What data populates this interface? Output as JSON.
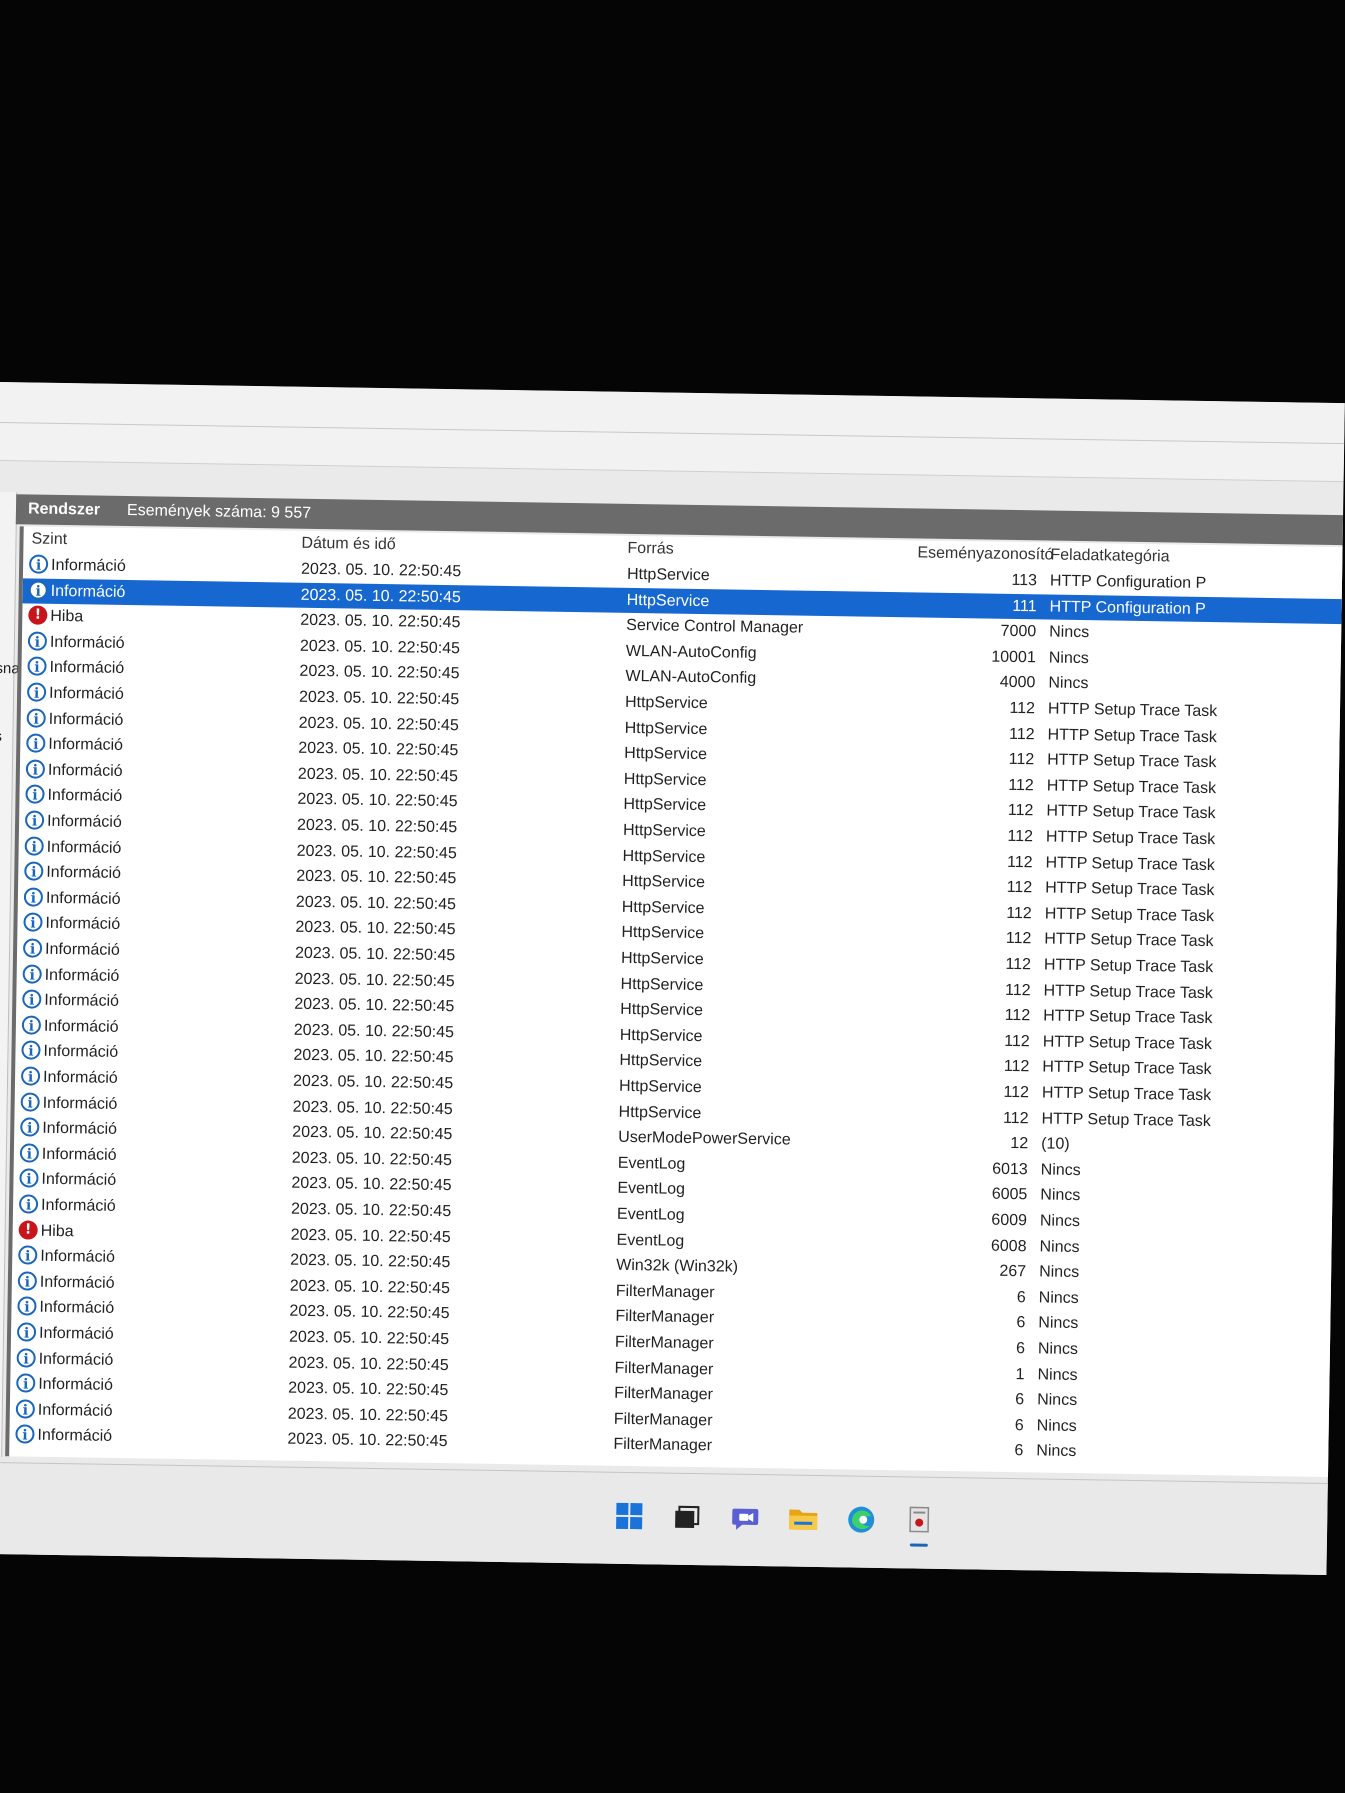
{
  "panel": {
    "title": "Rendszer",
    "count_text": "Események száma: 9 557"
  },
  "left_edge": [
    "sna",
    "s"
  ],
  "columns": {
    "level": "Szint",
    "date": "Dátum és idő",
    "source": "Forrás",
    "id": "Eseményazonosító",
    "category": "Feladatkategória"
  },
  "rows": [
    {
      "level": "Információ",
      "type": "info",
      "date": "2023. 05. 10. 22:50:45",
      "source": "HttpService",
      "id": "113",
      "category": "HTTP Configuration P"
    },
    {
      "level": "Információ",
      "type": "info",
      "date": "2023. 05. 10. 22:50:45",
      "source": "HttpService",
      "id": "111",
      "category": "HTTP Configuration P",
      "selected": true
    },
    {
      "level": "Hiba",
      "type": "error",
      "date": "2023. 05. 10. 22:50:45",
      "source": "Service Control Manager",
      "id": "7000",
      "category": "Nincs"
    },
    {
      "level": "Információ",
      "type": "info",
      "date": "2023. 05. 10. 22:50:45",
      "source": "WLAN-AutoConfig",
      "id": "10001",
      "category": "Nincs"
    },
    {
      "level": "Információ",
      "type": "info",
      "date": "2023. 05. 10. 22:50:45",
      "source": "WLAN-AutoConfig",
      "id": "4000",
      "category": "Nincs"
    },
    {
      "level": "Információ",
      "type": "info",
      "date": "2023. 05. 10. 22:50:45",
      "source": "HttpService",
      "id": "112",
      "category": "HTTP Setup Trace Task"
    },
    {
      "level": "Információ",
      "type": "info",
      "date": "2023. 05. 10. 22:50:45",
      "source": "HttpService",
      "id": "112",
      "category": "HTTP Setup Trace Task"
    },
    {
      "level": "Információ",
      "type": "info",
      "date": "2023. 05. 10. 22:50:45",
      "source": "HttpService",
      "id": "112",
      "category": "HTTP Setup Trace Task"
    },
    {
      "level": "Információ",
      "type": "info",
      "date": "2023. 05. 10. 22:50:45",
      "source": "HttpService",
      "id": "112",
      "category": "HTTP Setup Trace Task"
    },
    {
      "level": "Információ",
      "type": "info",
      "date": "2023. 05. 10. 22:50:45",
      "source": "HttpService",
      "id": "112",
      "category": "HTTP Setup Trace Task"
    },
    {
      "level": "Információ",
      "type": "info",
      "date": "2023. 05. 10. 22:50:45",
      "source": "HttpService",
      "id": "112",
      "category": "HTTP Setup Trace Task"
    },
    {
      "level": "Információ",
      "type": "info",
      "date": "2023. 05. 10. 22:50:45",
      "source": "HttpService",
      "id": "112",
      "category": "HTTP Setup Trace Task"
    },
    {
      "level": "Információ",
      "type": "info",
      "date": "2023. 05. 10. 22:50:45",
      "source": "HttpService",
      "id": "112",
      "category": "HTTP Setup Trace Task"
    },
    {
      "level": "Információ",
      "type": "info",
      "date": "2023. 05. 10. 22:50:45",
      "source": "HttpService",
      "id": "112",
      "category": "HTTP Setup Trace Task"
    },
    {
      "level": "Információ",
      "type": "info",
      "date": "2023. 05. 10. 22:50:45",
      "source": "HttpService",
      "id": "112",
      "category": "HTTP Setup Trace Task"
    },
    {
      "level": "Információ",
      "type": "info",
      "date": "2023. 05. 10. 22:50:45",
      "source": "HttpService",
      "id": "112",
      "category": "HTTP Setup Trace Task"
    },
    {
      "level": "Információ",
      "type": "info",
      "date": "2023. 05. 10. 22:50:45",
      "source": "HttpService",
      "id": "112",
      "category": "HTTP Setup Trace Task"
    },
    {
      "level": "Információ",
      "type": "info",
      "date": "2023. 05. 10. 22:50:45",
      "source": "HttpService",
      "id": "112",
      "category": "HTTP Setup Trace Task"
    },
    {
      "level": "Információ",
      "type": "info",
      "date": "2023. 05. 10. 22:50:45",
      "source": "HttpService",
      "id": "112",
      "category": "HTTP Setup Trace Task"
    },
    {
      "level": "Információ",
      "type": "info",
      "date": "2023. 05. 10. 22:50:45",
      "source": "HttpService",
      "id": "112",
      "category": "HTTP Setup Trace Task"
    },
    {
      "level": "Információ",
      "type": "info",
      "date": "2023. 05. 10. 22:50:45",
      "source": "HttpService",
      "id": "112",
      "category": "HTTP Setup Trace Task"
    },
    {
      "level": "Információ",
      "type": "info",
      "date": "2023. 05. 10. 22:50:45",
      "source": "HttpService",
      "id": "112",
      "category": "HTTP Setup Trace Task"
    },
    {
      "level": "Információ",
      "type": "info",
      "date": "2023. 05. 10. 22:50:45",
      "source": "UserModePowerService",
      "id": "12",
      "category": "(10)"
    },
    {
      "level": "Információ",
      "type": "info",
      "date": "2023. 05. 10. 22:50:45",
      "source": "EventLog",
      "id": "6013",
      "category": "Nincs"
    },
    {
      "level": "Információ",
      "type": "info",
      "date": "2023. 05. 10. 22:50:45",
      "source": "EventLog",
      "id": "6005",
      "category": "Nincs"
    },
    {
      "level": "Információ",
      "type": "info",
      "date": "2023. 05. 10. 22:50:45",
      "source": "EventLog",
      "id": "6009",
      "category": "Nincs"
    },
    {
      "level": "Hiba",
      "type": "error",
      "date": "2023. 05. 10. 22:50:45",
      "source": "EventLog",
      "id": "6008",
      "category": "Nincs"
    },
    {
      "level": "Információ",
      "type": "info",
      "date": "2023. 05. 10. 22:50:45",
      "source": "Win32k (Win32k)",
      "id": "267",
      "category": "Nincs"
    },
    {
      "level": "Információ",
      "type": "info",
      "date": "2023. 05. 10. 22:50:45",
      "source": "FilterManager",
      "id": "6",
      "category": "Nincs"
    },
    {
      "level": "Információ",
      "type": "info",
      "date": "2023. 05. 10. 22:50:45",
      "source": "FilterManager",
      "id": "6",
      "category": "Nincs"
    },
    {
      "level": "Információ",
      "type": "info",
      "date": "2023. 05. 10. 22:50:45",
      "source": "FilterManager",
      "id": "6",
      "category": "Nincs"
    },
    {
      "level": "Információ",
      "type": "info",
      "date": "2023. 05. 10. 22:50:45",
      "source": "FilterManager",
      "id": "1",
      "category": "Nincs"
    },
    {
      "level": "Információ",
      "type": "info",
      "date": "2023. 05. 10. 22:50:45",
      "source": "FilterManager",
      "id": "6",
      "category": "Nincs"
    },
    {
      "level": "Információ",
      "type": "info",
      "date": "2023. 05. 10. 22:50:45",
      "source": "FilterManager",
      "id": "6",
      "category": "Nincs"
    },
    {
      "level": "Információ",
      "type": "info",
      "date": "2023. 05. 10. 22:50:45",
      "source": "FilterManager",
      "id": "6",
      "category": "Nincs"
    }
  ],
  "taskbar": [
    {
      "name": "start-icon"
    },
    {
      "name": "task-view-icon"
    },
    {
      "name": "chat-icon"
    },
    {
      "name": "file-explorer-icon"
    },
    {
      "name": "edge-browser-icon"
    },
    {
      "name": "event-viewer-icon",
      "active": true
    }
  ],
  "colors": {
    "selection": "#1767d1",
    "header": "#6b6b6b",
    "info_icon": "#1a66b8",
    "error_icon": "#c8151b"
  }
}
